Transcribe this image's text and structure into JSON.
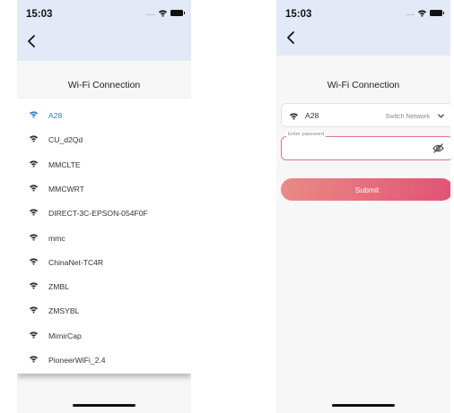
{
  "left_screen": {
    "status_time": "15:03",
    "title": "Wi-Fi Connection",
    "networks": [
      {
        "name": "A28",
        "selected": true
      },
      {
        "name": "CU_d2Qd",
        "selected": false
      },
      {
        "name": "MMCLTE",
        "selected": false
      },
      {
        "name": "MMCWRT",
        "selected": false
      },
      {
        "name": "DIRECT-3C-EPSON-054F0F",
        "selected": false
      },
      {
        "name": "mmc",
        "selected": false
      },
      {
        "name": "ChinaNet-TC4R",
        "selected": false
      },
      {
        "name": "ZMBL",
        "selected": false
      },
      {
        "name": "ZMSYBL",
        "selected": false
      },
      {
        "name": "MimirCap",
        "selected": false
      },
      {
        "name": "PioneerWiFi_2.4",
        "selected": false
      }
    ]
  },
  "right_screen": {
    "status_time": "15:03",
    "title": "Wi-Fi Connection",
    "network_name": "A28",
    "switch_label": "Switch Network",
    "password_label": "Enter password",
    "password_value": "",
    "submit_label": "Submit"
  },
  "colors": {
    "accent_blue": "#2f7bd8",
    "header_bg": "#e3e9f7",
    "submit_gradient_start": "#ea8a85",
    "submit_gradient_end": "#e25274",
    "password_border": "#e2738a"
  },
  "icons": [
    "back-chevron-icon",
    "wifi-icon",
    "battery-icon",
    "chevron-down-icon",
    "eye-off-icon"
  ]
}
